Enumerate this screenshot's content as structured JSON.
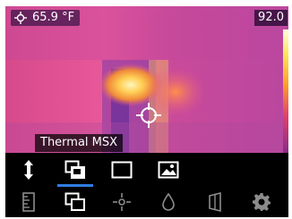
{
  "readout": {
    "spot_icon": "crosshair-icon",
    "temperature": "65.9 °F"
  },
  "scale": {
    "max": "92.0"
  },
  "mode": {
    "label": "Thermal MSX"
  },
  "toolbar": {
    "selected_color": "#2f7de1",
    "top_row": [
      "vertical-arrows-icon",
      "image-mode-icon",
      "rectangle-icon",
      "picture-icon"
    ],
    "bottom_row": [
      "measure-ruler-icon",
      "image-mode-icon",
      "spot-meter-icon",
      "water-drop-icon",
      "emissivity-icon",
      "gear-icon"
    ]
  }
}
